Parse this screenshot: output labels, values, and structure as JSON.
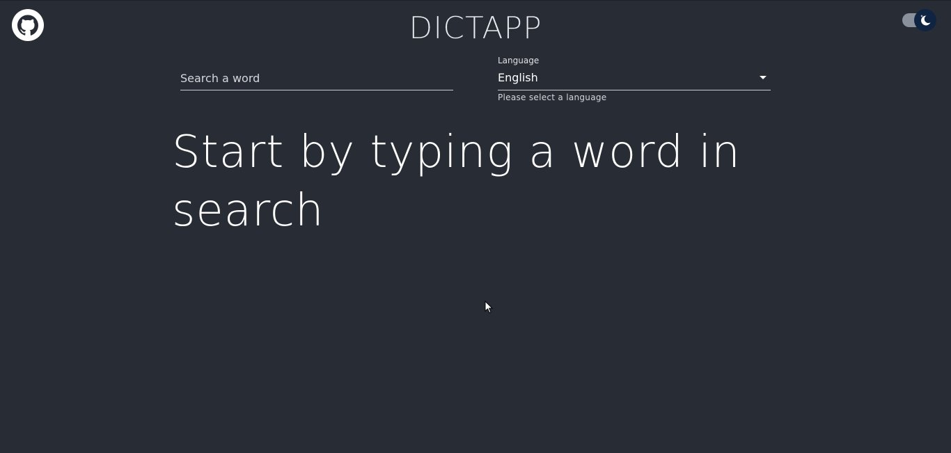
{
  "header": {
    "title": "DICTAPP",
    "github_icon": "github-icon",
    "theme_toggle_icon": "moon-icon"
  },
  "search": {
    "placeholder": "Search a word",
    "value": ""
  },
  "language": {
    "label": "Language",
    "selected": "English",
    "helper": "Please select a language"
  },
  "main": {
    "message": "Start by typing a word in search"
  },
  "colors": {
    "background": "#282c34",
    "text": "#ffffff",
    "toggle_thumb": "#0f2342",
    "toggle_track": "#8a919c"
  }
}
